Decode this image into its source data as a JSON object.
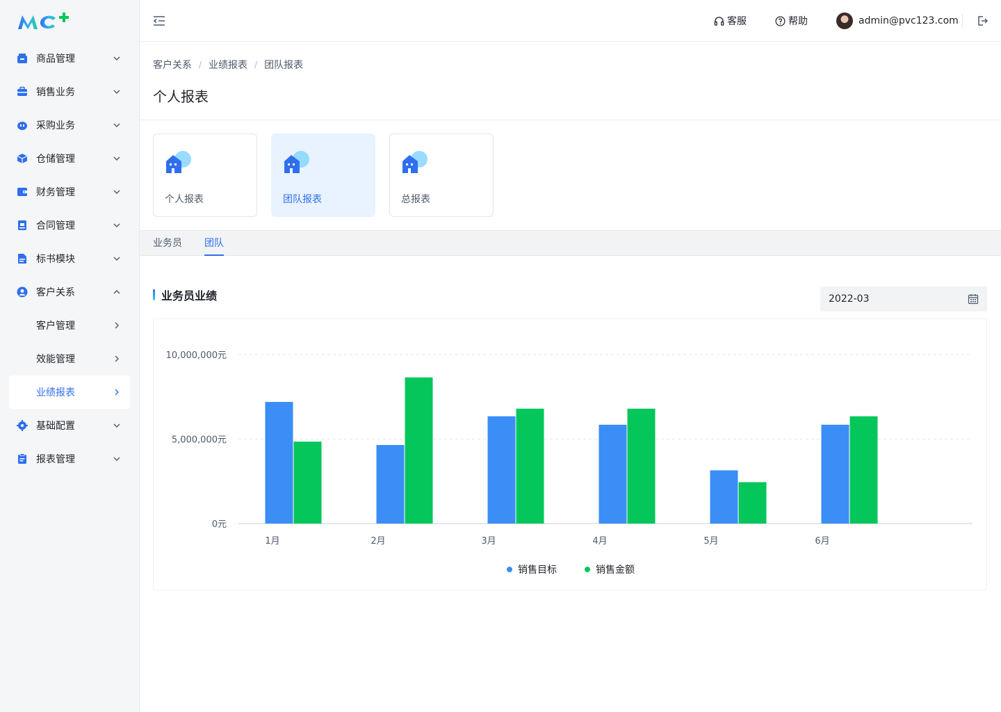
{
  "app": {
    "logo_text": "MC+"
  },
  "sidebar": {
    "items": [
      {
        "label": "商品管理",
        "icon": "box-icon",
        "expanded": false
      },
      {
        "label": "销售业务",
        "icon": "briefcase-icon",
        "expanded": false
      },
      {
        "label": "采购业务",
        "icon": "cart-icon",
        "expanded": false
      },
      {
        "label": "仓储管理",
        "icon": "cube-icon",
        "expanded": false
      },
      {
        "label": "财务管理",
        "icon": "wallet-icon",
        "expanded": false
      },
      {
        "label": "合同管理",
        "icon": "contract-icon",
        "expanded": false
      },
      {
        "label": "标书模块",
        "icon": "document-icon",
        "expanded": false
      },
      {
        "label": "客户关系",
        "icon": "user-circle-icon",
        "expanded": true
      },
      {
        "label": "客户管理",
        "sub": true
      },
      {
        "label": "效能管理",
        "sub": true
      },
      {
        "label": "业绩报表",
        "sub": true,
        "active": true
      },
      {
        "label": "基础配置",
        "icon": "gear-icon",
        "expanded": false
      },
      {
        "label": "报表管理",
        "icon": "clipboard-icon",
        "expanded": false
      }
    ]
  },
  "header": {
    "service_label": "客服",
    "help_label": "帮助",
    "user_email": "admin@pvc123.com"
  },
  "breadcrumb": [
    "客户关系",
    "业绩报表",
    "团队报表"
  ],
  "page_title": "个人报表",
  "report_cards": [
    {
      "label": "个人报表",
      "active": false
    },
    {
      "label": "团队报表",
      "active": true
    },
    {
      "label": "总报表",
      "active": false
    }
  ],
  "tabs": [
    {
      "label": "业务员",
      "active": false
    },
    {
      "label": "团队",
      "active": true
    }
  ],
  "section": {
    "title": "业务员业绩"
  },
  "date_picker": {
    "value": "2022-03"
  },
  "colors": {
    "accent": "#2f6fed",
    "target": "#3a8ef6",
    "amount": "#05c65b"
  },
  "chart_data": {
    "type": "bar",
    "categories": [
      "1月",
      "2月",
      "3月",
      "4月",
      "5月",
      "6月"
    ],
    "series": [
      {
        "name": "销售目标",
        "values": [
          7200000,
          4650000,
          6350000,
          5850000,
          3150000,
          5850000
        ]
      },
      {
        "name": "销售金额",
        "values": [
          4850000,
          8650000,
          6800000,
          6800000,
          2450000,
          6350000
        ]
      }
    ],
    "ylim": [
      0,
      10000000
    ],
    "y_ticks": [
      {
        "value": 0,
        "label": "0元"
      },
      {
        "value": 5000000,
        "label": "5,000,000元"
      },
      {
        "value": 10000000,
        "label": "10,000,000元"
      }
    ],
    "grid": true,
    "legend_position": "bottom-center"
  }
}
